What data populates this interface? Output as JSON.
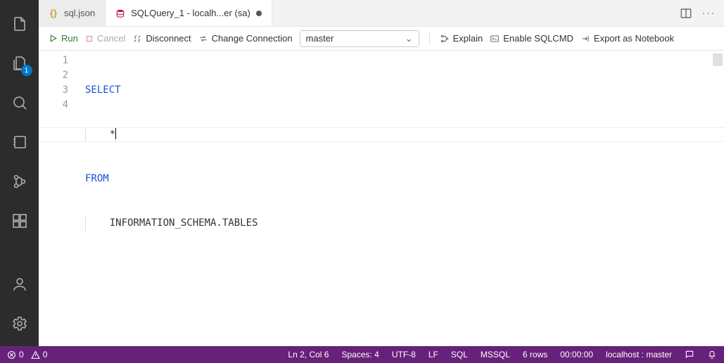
{
  "activity_badge": "1",
  "tabs": {
    "inactive_label": "sql.json",
    "active_label": "SQLQuery_1 - localh...er (sa)"
  },
  "toolbar": {
    "run": "Run",
    "cancel": "Cancel",
    "disconnect": "Disconnect",
    "change_connection": "Change Connection",
    "db_selected": "master",
    "explain": "Explain",
    "enable_sqlcmd": "Enable SQLCMD",
    "export_notebook": "Export as Notebook"
  },
  "editor": {
    "lines": {
      "n1": "1",
      "n2": "2",
      "n3": "3",
      "n4": "4"
    },
    "kw_select": "SELECT",
    "star": "*",
    "kw_from": "FROM",
    "table": "INFORMATION_SCHEMA.TABLES"
  },
  "status": {
    "errors": "0",
    "warnings": "0",
    "ln_col": "Ln 2, Col 6",
    "spaces": "Spaces: 4",
    "encoding": "UTF-8",
    "eol": "LF",
    "lang": "SQL",
    "engine": "MSSQL",
    "rows": "6 rows",
    "time": "00:00:00",
    "conn": "localhost : master"
  }
}
